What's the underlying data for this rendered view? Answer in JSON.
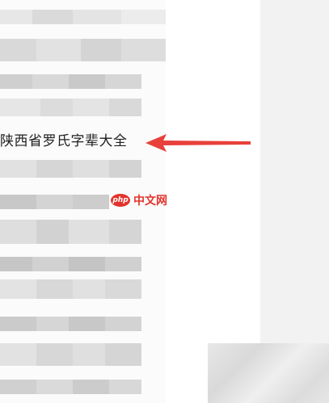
{
  "content": {
    "highlight_text": "陕西省罗氏字辈大全"
  },
  "watermark": {
    "logo": "php",
    "text": "中文网"
  },
  "colors": {
    "arrow": "#e8403a",
    "watermark": "#e3332c",
    "text": "#1f1f1f"
  },
  "icons": {
    "arrow": "left-arrow-icon"
  }
}
